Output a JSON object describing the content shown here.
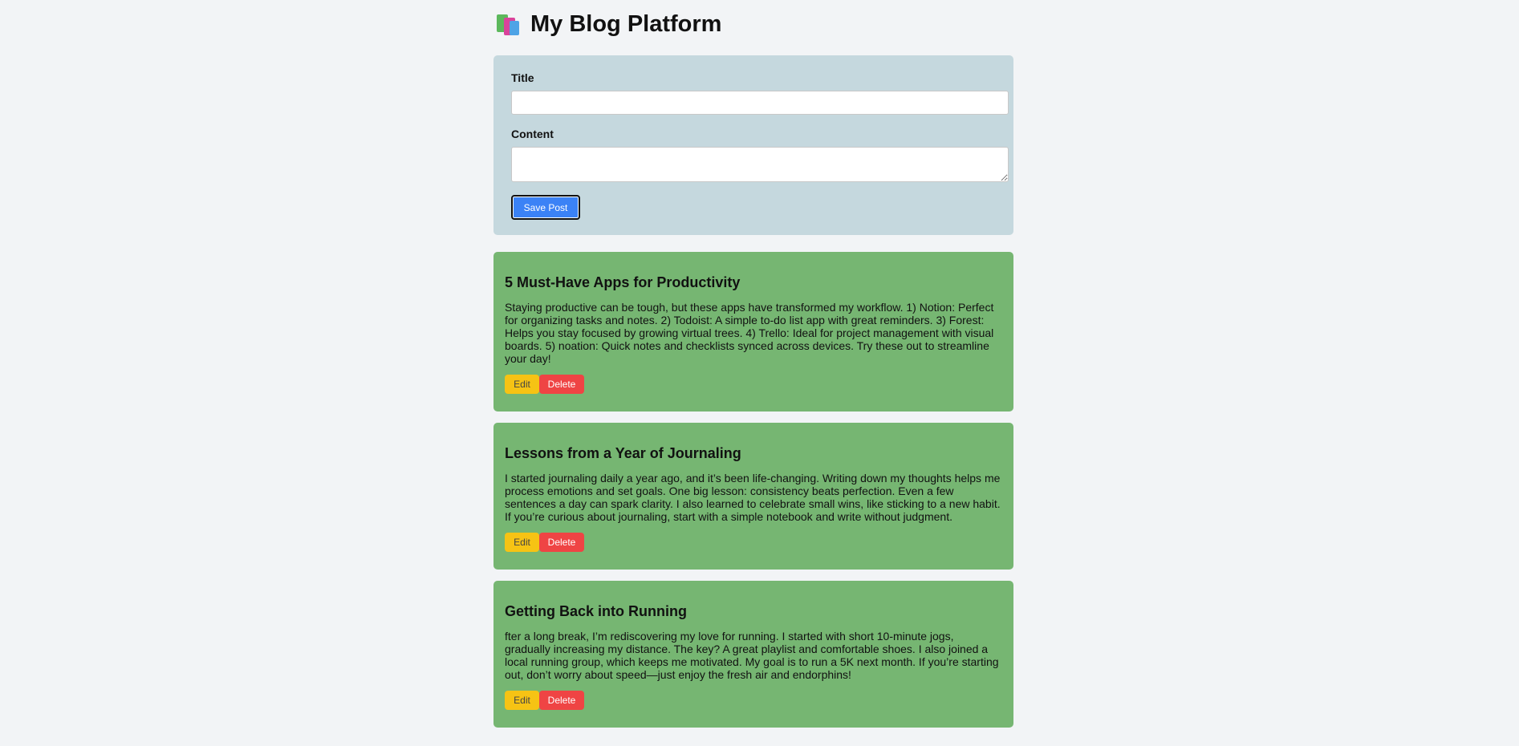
{
  "header": {
    "title": "My Blog Platform",
    "logo_icon": "books-icon"
  },
  "editor": {
    "title_label": "Title",
    "title_value": "",
    "content_label": "Content",
    "content_value": "",
    "save_label": "Save Post"
  },
  "colors": {
    "page_bg": "#f2f4f6",
    "editor_bg": "#c5d8de",
    "post_bg": "#76b672",
    "save_button": "#3b82f6",
    "edit_button": "#f6c314",
    "delete_button": "#ef4444"
  },
  "posts": [
    {
      "title": "5 Must-Have Apps for Productivity",
      "body": "Staying productive can be tough, but these apps have transformed my workflow. 1) Notion: Perfect for organizing tasks and notes. 2) Todoist: A simple to-do list app with great reminders. 3) Forest: Helps you stay focused by growing virtual trees. 4) Trello: Ideal for project management with visual boards. 5) noation: Quick notes and checklists synced across devices. Try these out to streamline your day!",
      "edit_label": "Edit",
      "delete_label": "Delete"
    },
    {
      "title": "Lessons from a Year of Journaling",
      "body": "I started journaling daily a year ago, and it’s been life-changing. Writing down my thoughts helps me process emotions and set goals. One big lesson: consistency beats perfection. Even a few sentences a day can spark clarity. I also learned to celebrate small wins, like sticking to a new habit. If you’re curious about journaling, start with a simple notebook and write without judgment.",
      "edit_label": "Edit",
      "delete_label": "Delete"
    },
    {
      "title": "Getting Back into Running",
      "body": "fter a long break, I’m rediscovering my love for running. I started with short 10-minute jogs, gradually increasing my distance. The key? A great playlist and comfortable shoes. I also joined a local running group, which keeps me motivated. My goal is to run a 5K next month. If you’re starting out, don’t worry about speed—just enjoy the fresh air and endorphins!",
      "edit_label": "Edit",
      "delete_label": "Delete"
    }
  ]
}
